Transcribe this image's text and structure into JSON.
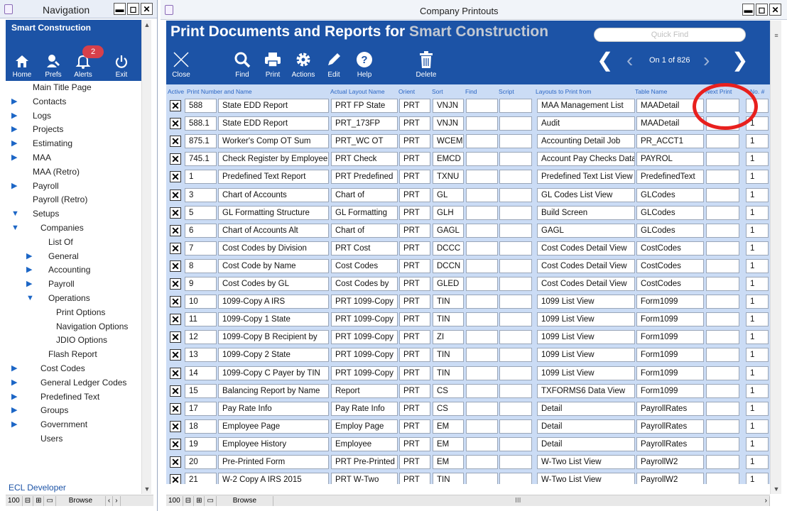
{
  "nav_window": {
    "title": "Navigation",
    "company": "Smart Construction",
    "alerts_count": "2",
    "tools": [
      {
        "label": "Home",
        "icon": "home-icon"
      },
      {
        "label": "Prefs",
        "icon": "prefs-icon"
      },
      {
        "label": "Alerts",
        "icon": "bell-icon"
      },
      {
        "label": "Exit",
        "icon": "power-icon"
      }
    ],
    "tree": [
      {
        "label": "Main Title Page",
        "level": 0,
        "arrow": "none"
      },
      {
        "label": "Contacts",
        "level": 0,
        "arrow": "right"
      },
      {
        "label": "Logs",
        "level": 0,
        "arrow": "right"
      },
      {
        "label": "Projects",
        "level": 0,
        "arrow": "right"
      },
      {
        "label": "Estimating",
        "level": 0,
        "arrow": "right"
      },
      {
        "label": "MAA",
        "level": 0,
        "arrow": "right"
      },
      {
        "label": "MAA (Retro)",
        "level": 0,
        "arrow": "none"
      },
      {
        "label": "Payroll",
        "level": 0,
        "arrow": "right"
      },
      {
        "label": "Payroll (Retro)",
        "level": 0,
        "arrow": "none"
      },
      {
        "label": "Setups",
        "level": 0,
        "arrow": "down"
      },
      {
        "label": "Companies",
        "level": 1,
        "arrow": "down"
      },
      {
        "label": "List Of",
        "level": 2,
        "arrow": "none"
      },
      {
        "label": "General",
        "level": 2,
        "arrow": "right"
      },
      {
        "label": "Accounting",
        "level": 2,
        "arrow": "right"
      },
      {
        "label": "Payroll",
        "level": 2,
        "arrow": "right"
      },
      {
        "label": "Operations",
        "level": 2,
        "arrow": "down"
      },
      {
        "label": "Print Options",
        "level": 3,
        "arrow": "none"
      },
      {
        "label": "Navigation Options",
        "level": 3,
        "arrow": "none"
      },
      {
        "label": "JDIO Options",
        "level": 3,
        "arrow": "none"
      },
      {
        "label": "Flash Report",
        "level": 2,
        "arrow": "none"
      },
      {
        "label": "Cost Codes",
        "level": 1,
        "arrow": "right"
      },
      {
        "label": "General Ledger Codes",
        "level": 1,
        "arrow": "right"
      },
      {
        "label": "Predefined Text",
        "level": 1,
        "arrow": "right"
      },
      {
        "label": "Groups",
        "level": 1,
        "arrow": "right"
      },
      {
        "label": "Government",
        "level": 1,
        "arrow": "right"
      },
      {
        "label": "Users",
        "level": 1,
        "arrow": "none"
      }
    ],
    "footer_link": "ECL Developer",
    "status": {
      "zoom": "100",
      "mode": "Browse"
    }
  },
  "main_window": {
    "title": "Company Printouts",
    "heading_prefix": "Print Documents and Reports for",
    "heading_company": "Smart Construction",
    "quick_find_placeholder": "Quick Find",
    "toolbar": [
      {
        "label": "Close",
        "icon": "close-icon"
      },
      {
        "label": "Find",
        "icon": "search-icon"
      },
      {
        "label": "Print",
        "icon": "printer-icon"
      },
      {
        "label": "Actions",
        "icon": "gear-icon"
      },
      {
        "label": "Edit",
        "icon": "pencil-icon"
      },
      {
        "label": "Help",
        "icon": "help-icon"
      },
      {
        "label": "Delete",
        "icon": "trash-icon"
      }
    ],
    "record_position": "On 1 of 826",
    "columns": [
      "Active",
      "Print Number and Name",
      "Actual Layout Name",
      "Orient",
      "Sort",
      "Find",
      "Script",
      "Layouts to Print from",
      "Table Name",
      "Next Print",
      "No. #"
    ],
    "rows": [
      {
        "num": "588",
        "name": "State EDD Report",
        "layout": "PRT FP State",
        "orient": "PRT",
        "sort": "VNJN",
        "find": "",
        "script": "",
        "print_from": "MAA Management List",
        "table": "MAADetail",
        "next_print": "",
        "no": ""
      },
      {
        "num": "588.1",
        "name": "State EDD Report",
        "layout": "PRT_173FP",
        "orient": "PRT",
        "sort": "VNJN",
        "find": "",
        "script": "",
        "print_from": "Audit",
        "table": "MAADetail",
        "next_print": "",
        "no": "1"
      },
      {
        "num": "875.1",
        "name": "Worker's Comp OT Sum",
        "layout": "PRT_WC OT",
        "orient": "PRT",
        "sort": "WCEM",
        "find": "",
        "script": "",
        "print_from": "Accounting Detail Job",
        "table": "PR_ACCT1",
        "next_print": "",
        "no": "1"
      },
      {
        "num": "745.1",
        "name": "Check Register by Employee",
        "layout": "PRT Check",
        "orient": "PRT",
        "sort": "EMCD",
        "find": "",
        "script": "",
        "print_from": "Account Pay Checks Data",
        "table": "PAYROL",
        "next_print": "",
        "no": "1"
      },
      {
        "num": "1",
        "name": "Predefined Text Report",
        "layout": "PRT Predefined",
        "orient": "PRT",
        "sort": "TXNU",
        "find": "",
        "script": "",
        "print_from": "Predefined Text List View",
        "table": "PredefinedText",
        "next_print": "",
        "no": "1"
      },
      {
        "num": "3",
        "name": "Chart of Accounts",
        "layout": "Chart of",
        "orient": "PRT",
        "sort": "GL",
        "find": "",
        "script": "",
        "print_from": "GL Codes List View",
        "table": "GLCodes",
        "next_print": "",
        "no": "1"
      },
      {
        "num": "5",
        "name": "GL Formatting Structure",
        "layout": "GL Formatting",
        "orient": "PRT",
        "sort": "GLH",
        "find": "",
        "script": "",
        "print_from": "Build Screen",
        "table": "GLCodes",
        "next_print": "",
        "no": "1"
      },
      {
        "num": "6",
        "name": "Chart of Accounts Alt",
        "layout": "Chart of",
        "orient": "PRT",
        "sort": "GAGL",
        "find": "",
        "script": "",
        "print_from": "GAGL",
        "table": "GLCodes",
        "next_print": "",
        "no": "1"
      },
      {
        "num": "7",
        "name": "Cost Codes by Division",
        "layout": "PRT Cost",
        "orient": "PRT",
        "sort": "DCCC",
        "find": "",
        "script": "",
        "print_from": "Cost Codes Detail View",
        "table": "CostCodes",
        "next_print": "",
        "no": "1"
      },
      {
        "num": "8",
        "name": "Cost Code by Name",
        "layout": "Cost Codes",
        "orient": "PRT",
        "sort": "DCCN",
        "find": "",
        "script": "",
        "print_from": "Cost Codes Detail View",
        "table": "CostCodes",
        "next_print": "",
        "no": "1"
      },
      {
        "num": "9",
        "name": "Cost Codes by GL",
        "layout": "Cost Codes by",
        "orient": "PRT",
        "sort": "GLED",
        "find": "",
        "script": "",
        "print_from": "Cost Codes Detail View",
        "table": "CostCodes",
        "next_print": "",
        "no": "1"
      },
      {
        "num": "10",
        "name": "1099-Copy A IRS",
        "layout": "PRT 1099-Copy",
        "orient": "PRT",
        "sort": "TIN",
        "find": "",
        "script": "",
        "print_from": "1099 List View",
        "table": "Form1099",
        "next_print": "",
        "no": "1"
      },
      {
        "num": "11",
        "name": "1099-Copy 1 State",
        "layout": "PRT 1099-Copy",
        "orient": "PRT",
        "sort": "TIN",
        "find": "",
        "script": "",
        "print_from": "1099 List View",
        "table": "Form1099",
        "next_print": "",
        "no": "1"
      },
      {
        "num": "12",
        "name": "1099-Copy B Recipient by",
        "layout": "PRT 1099-Copy",
        "orient": "PRT",
        "sort": "ZI",
        "find": "",
        "script": "",
        "print_from": "1099 List View",
        "table": "Form1099",
        "next_print": "",
        "no": "1"
      },
      {
        "num": "13",
        "name": "1099-Copy 2 State",
        "layout": "PRT 1099-Copy",
        "orient": "PRT",
        "sort": "TIN",
        "find": "",
        "script": "",
        "print_from": "1099 List View",
        "table": "Form1099",
        "next_print": "",
        "no": "1"
      },
      {
        "num": "14",
        "name": "1099-Copy C Payer by TIN",
        "layout": "PRT 1099-Copy",
        "orient": "PRT",
        "sort": "TIN",
        "find": "",
        "script": "",
        "print_from": "1099 List View",
        "table": "Form1099",
        "next_print": "",
        "no": "1"
      },
      {
        "num": "15",
        "name": "Balancing Report by Name",
        "layout": "Report",
        "orient": "PRT",
        "sort": "CS",
        "find": "",
        "script": "",
        "print_from": "TXFORMS6 Data View",
        "table": "Form1099",
        "next_print": "",
        "no": "1"
      },
      {
        "num": "17",
        "name": "Pay Rate Info",
        "layout": "Pay Rate Info",
        "orient": "PRT",
        "sort": "CS",
        "find": "",
        "script": "",
        "print_from": "Detail",
        "table": "PayrollRates",
        "next_print": "",
        "no": "1"
      },
      {
        "num": "18",
        "name": "Employee Page",
        "layout": "Employ Page",
        "orient": "PRT",
        "sort": "EM",
        "find": "",
        "script": "",
        "print_from": "Detail",
        "table": "PayrollRates",
        "next_print": "",
        "no": "1"
      },
      {
        "num": "19",
        "name": "Employee History",
        "layout": "Employee",
        "orient": "PRT",
        "sort": "EM",
        "find": "",
        "script": "",
        "print_from": "Detail",
        "table": "PayrollRates",
        "next_print": "",
        "no": "1"
      },
      {
        "num": "20",
        "name": "Pre-Printed Form",
        "layout": "PRT Pre-Printed",
        "orient": "PRT",
        "sort": "EM",
        "find": "",
        "script": "",
        "print_from": "W-Two List View",
        "table": "PayrollW2",
        "next_print": "",
        "no": "1"
      },
      {
        "num": "21",
        "name": "W-2 Copy A IRS 2015",
        "layout": "PRT W-Two",
        "orient": "PRT",
        "sort": "TIN",
        "find": "",
        "script": "",
        "print_from": "W-Two List View",
        "table": "PayrollW2",
        "next_print": "",
        "no": "1"
      }
    ],
    "status": {
      "zoom": "100",
      "mode": "Browse"
    }
  },
  "colors": {
    "header_blue": "#1c53a6",
    "list_bg": "#cbdcf5",
    "highlight_red": "#e8201e",
    "accent_gray": "#c3c9d2"
  }
}
